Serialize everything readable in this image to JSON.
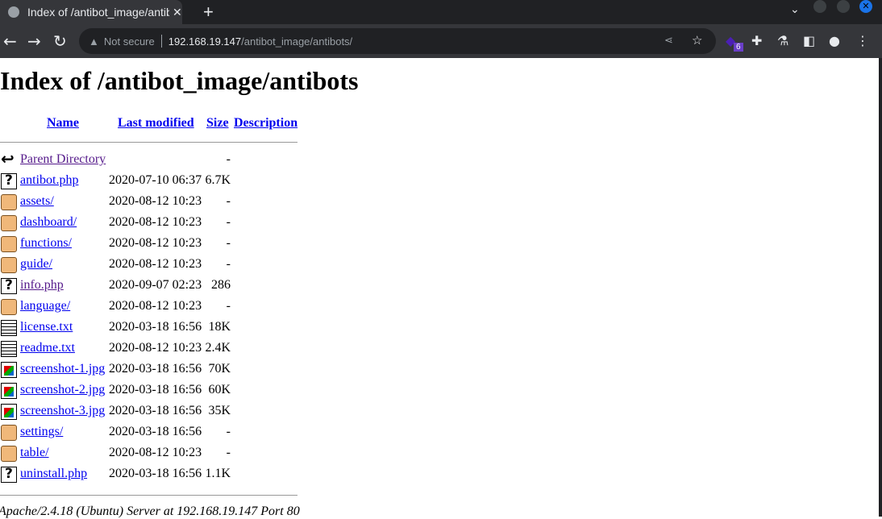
{
  "browser": {
    "tab_title": "Index of /antibot_image/antibots",
    "not_secure": "Not secure",
    "url_host": "192.168.19.147",
    "url_path": "/antibot_image/antibots/",
    "extension_badge": "6"
  },
  "page": {
    "title": "Index of /antibot_image/antibots",
    "columns": {
      "name": "Name",
      "modified": "Last modified",
      "size": "Size",
      "description": "Description"
    },
    "rows": [
      {
        "name": "Parent Directory",
        "date": "",
        "size": "-",
        "type": "back",
        "visited": true
      },
      {
        "name": "antibot.php",
        "date": "2020-07-10 06:37",
        "size": "6.7K",
        "type": "unknown"
      },
      {
        "name": "assets/",
        "date": "2020-08-12 10:23",
        "size": "-",
        "type": "folder"
      },
      {
        "name": "dashboard/",
        "date": "2020-08-12 10:23",
        "size": "-",
        "type": "folder"
      },
      {
        "name": "functions/",
        "date": "2020-08-12 10:23",
        "size": "-",
        "type": "folder"
      },
      {
        "name": "guide/",
        "date": "2020-08-12 10:23",
        "size": "-",
        "type": "folder"
      },
      {
        "name": "info.php",
        "date": "2020-09-07 02:23",
        "size": "286",
        "type": "unknown",
        "visited": true
      },
      {
        "name": "language/",
        "date": "2020-08-12 10:23",
        "size": "-",
        "type": "folder"
      },
      {
        "name": "license.txt",
        "date": "2020-03-18 16:56",
        "size": "18K",
        "type": "text"
      },
      {
        "name": "readme.txt",
        "date": "2020-08-12 10:23",
        "size": "2.4K",
        "type": "text"
      },
      {
        "name": "screenshot-1.jpg",
        "date": "2020-03-18 16:56",
        "size": "70K",
        "type": "image"
      },
      {
        "name": "screenshot-2.jpg",
        "date": "2020-03-18 16:56",
        "size": "60K",
        "type": "image"
      },
      {
        "name": "screenshot-3.jpg",
        "date": "2020-03-18 16:56",
        "size": "35K",
        "type": "image"
      },
      {
        "name": "settings/",
        "date": "2020-03-18 16:56",
        "size": "-",
        "type": "folder"
      },
      {
        "name": "table/",
        "date": "2020-08-12 10:23",
        "size": "-",
        "type": "folder"
      },
      {
        "name": "uninstall.php",
        "date": "2020-03-18 16:56",
        "size": "1.1K",
        "type": "unknown"
      }
    ],
    "footer": "Apache/2.4.18 (Ubuntu) Server at 192.168.19.147 Port 80"
  }
}
